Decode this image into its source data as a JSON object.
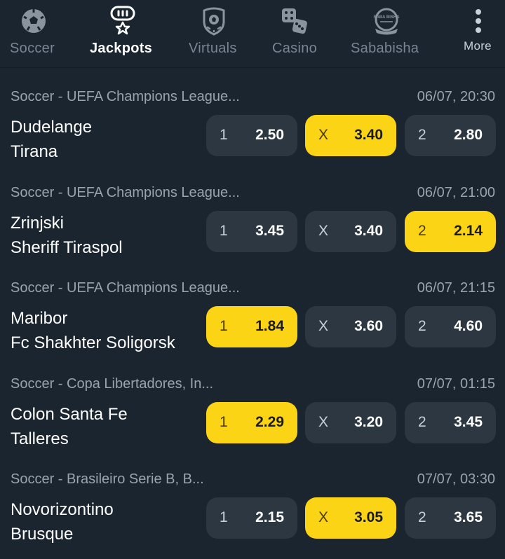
{
  "nav": {
    "items": [
      {
        "label": "Soccer",
        "icon": "soccer-ball-icon"
      },
      {
        "label": "Jackpots",
        "icon": "jackpot-trophy-icon"
      },
      {
        "label": "Virtuals",
        "icon": "virtuals-shield-icon"
      },
      {
        "label": "Casino",
        "icon": "dice-icon"
      },
      {
        "label": "Sababisha",
        "icon": "sababisha-badge-icon",
        "badge_text": "SABA BISHA"
      },
      {
        "label": "More",
        "icon": "more-vertical-icon"
      }
    ],
    "active": "Jackpots"
  },
  "colors": {
    "background": "#1b2530",
    "odd_button": "#2c3742",
    "selected": "#fbd415",
    "muted_text": "#9aa4af"
  },
  "matches": [
    {
      "league": "Soccer - UEFA Champions League...",
      "datetime": "06/07, 20:30",
      "home": "Dudelange",
      "away": "Tirana",
      "odds": [
        {
          "label": "1",
          "value": "2.50",
          "selected": false
        },
        {
          "label": "X",
          "value": "3.40",
          "selected": true
        },
        {
          "label": "2",
          "value": "2.80",
          "selected": false
        }
      ]
    },
    {
      "league": "Soccer - UEFA Champions League...",
      "datetime": "06/07, 21:00",
      "home": "Zrinjski",
      "away": "Sheriff Tiraspol",
      "odds": [
        {
          "label": "1",
          "value": "3.45",
          "selected": false
        },
        {
          "label": "X",
          "value": "3.40",
          "selected": false
        },
        {
          "label": "2",
          "value": "2.14",
          "selected": true
        }
      ]
    },
    {
      "league": "Soccer - UEFA Champions League...",
      "datetime": "06/07, 21:15",
      "home": "Maribor",
      "away": "Fc Shakhter Soligorsk",
      "odds": [
        {
          "label": "1",
          "value": "1.84",
          "selected": true
        },
        {
          "label": "X",
          "value": "3.60",
          "selected": false
        },
        {
          "label": "2",
          "value": "4.60",
          "selected": false
        }
      ]
    },
    {
      "league": "Soccer - Copa Libertadores, In...",
      "datetime": "07/07, 01:15",
      "home": "Colon Santa Fe",
      "away": "Talleres",
      "odds": [
        {
          "label": "1",
          "value": "2.29",
          "selected": true
        },
        {
          "label": "X",
          "value": "3.20",
          "selected": false
        },
        {
          "label": "2",
          "value": "3.45",
          "selected": false
        }
      ]
    },
    {
      "league": "Soccer - Brasileiro Serie B, B...",
      "datetime": "07/07, 03:30",
      "home": "Novorizontino",
      "away": "Brusque",
      "odds": [
        {
          "label": "1",
          "value": "2.15",
          "selected": false
        },
        {
          "label": "X",
          "value": "3.05",
          "selected": true
        },
        {
          "label": "2",
          "value": "3.65",
          "selected": false
        }
      ]
    }
  ]
}
